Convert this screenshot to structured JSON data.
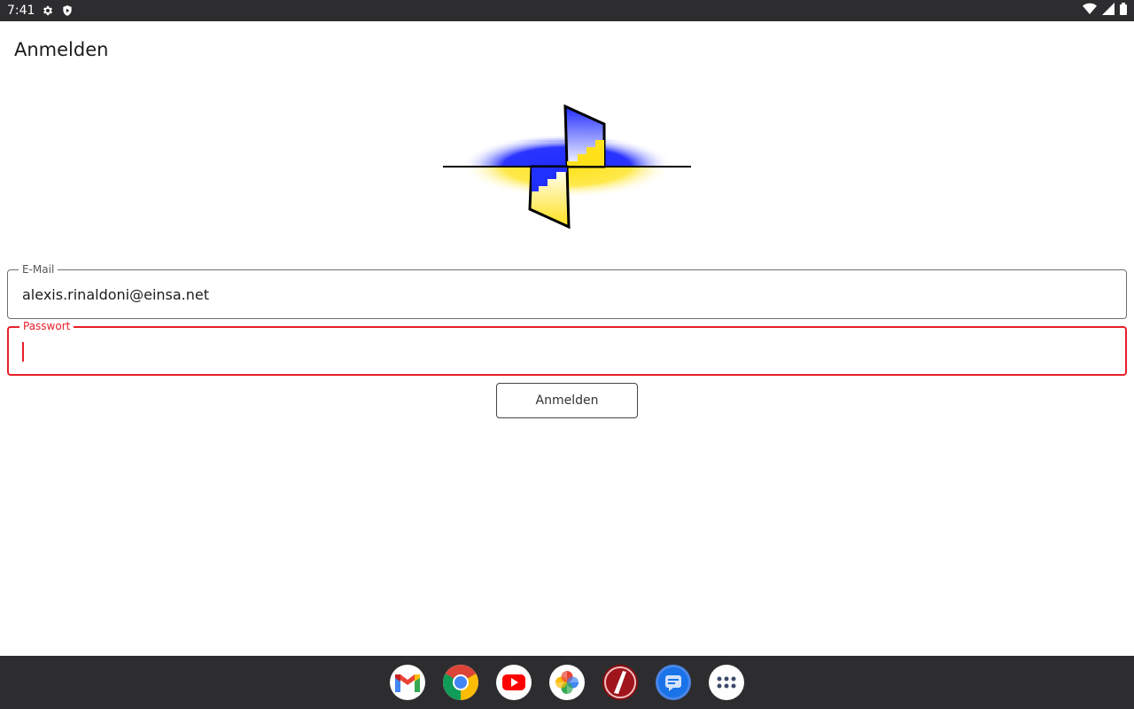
{
  "status_bar": {
    "time": "7:41",
    "left_icons": [
      "settings-icon",
      "shield-icon"
    ],
    "right_icons": [
      "wifi-icon",
      "signal-icon",
      "battery-icon"
    ]
  },
  "page": {
    "title": "Anmelden"
  },
  "form": {
    "email": {
      "label": "E-Mail",
      "value": "alexis.rinaldoni@einsa.net"
    },
    "password": {
      "label": "Passwort",
      "value": ""
    },
    "submit_label": "Anmelden"
  },
  "colors": {
    "error": "#e8202a",
    "logo_blue": "#1f2cff",
    "logo_yellow": "#ffe11a",
    "bar_background": "#2d2d2f"
  },
  "dock": {
    "apps": [
      "gmail-icon",
      "chrome-icon",
      "youtube-icon",
      "photos-icon",
      "custom-app-icon",
      "messages-icon",
      "app-drawer-icon"
    ]
  }
}
